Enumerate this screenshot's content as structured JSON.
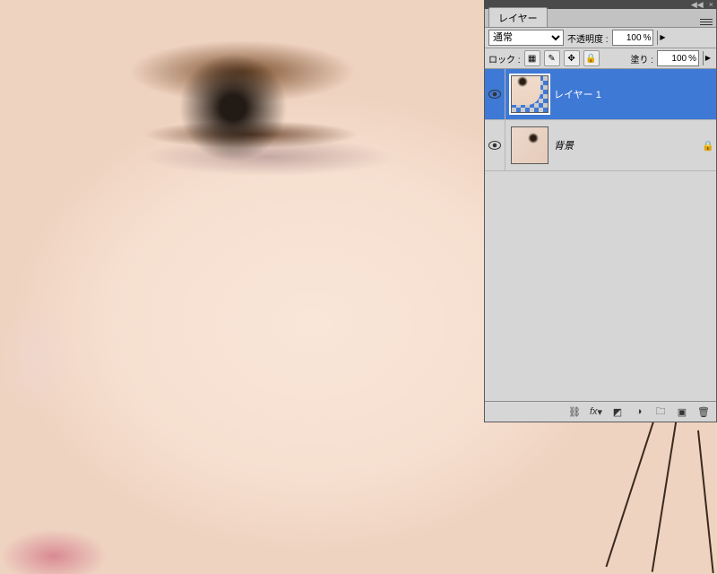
{
  "panel": {
    "tab_label": "レイヤー",
    "blend_mode_options": [
      "通常"
    ],
    "blend_mode_selected": "通常",
    "opacity_label": "不透明度 :",
    "opacity_value": "100",
    "opacity_suffix": "%",
    "lock_label": "ロック :",
    "fill_label": "塗り :",
    "fill_value": "100",
    "fill_suffix": "%"
  },
  "layers": [
    {
      "name": "レイヤー 1",
      "visible": true,
      "selected": true,
      "locked": false,
      "thumb": "t1"
    },
    {
      "name": "背景",
      "visible": true,
      "selected": false,
      "locked": true,
      "thumb": "t2",
      "is_background": true
    }
  ],
  "footer_icons": [
    "link",
    "fx",
    "mask",
    "adjust",
    "group",
    "new",
    "trash"
  ],
  "topbar_icons": [
    "collapse",
    "close"
  ]
}
